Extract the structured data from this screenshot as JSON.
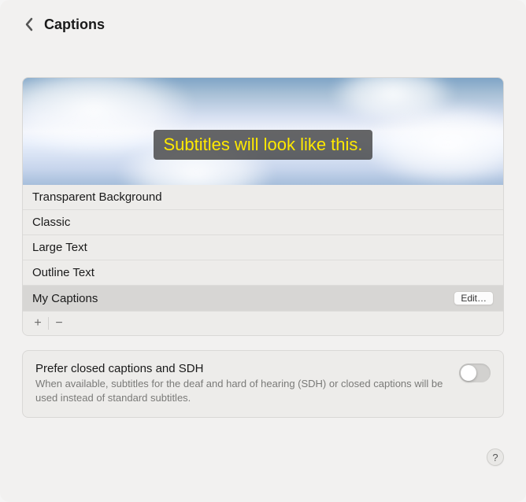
{
  "header": {
    "title": "Captions"
  },
  "preview": {
    "subtitle_text": "Subtitles will look like this."
  },
  "styles": [
    {
      "label": "Transparent Background",
      "selected": false,
      "editable": false
    },
    {
      "label": "Classic",
      "selected": false,
      "editable": false
    },
    {
      "label": "Large Text",
      "selected": false,
      "editable": false
    },
    {
      "label": "Outline Text",
      "selected": false,
      "editable": false
    },
    {
      "label": "My Captions",
      "selected": true,
      "editable": true
    }
  ],
  "edit_button_label": "Edit…",
  "prefer_box": {
    "title": "Prefer closed captions and SDH",
    "description": "When available, subtitles for the deaf and hard of hearing (SDH) or closed captions will be used instead of standard subtitles.",
    "enabled": false
  },
  "icons": {
    "add": "+",
    "remove": "−",
    "help": "?"
  }
}
